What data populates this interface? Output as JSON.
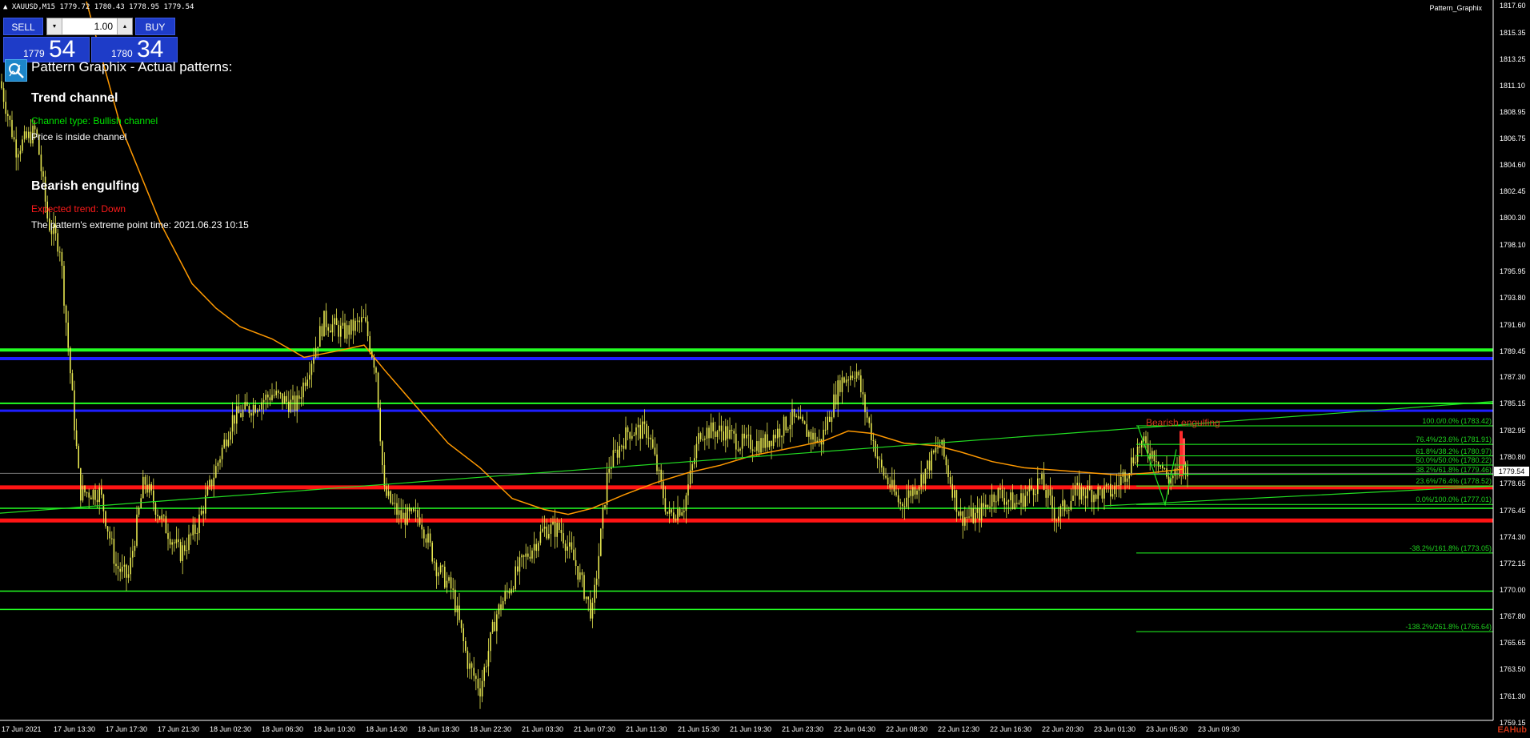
{
  "header": {
    "symbol_line": "▲ XAUUSD,M15  1779.72 1780.43 1778.95 1779.54",
    "indicator_label": "Pattern_Graphix"
  },
  "trade_panel": {
    "sell_label": "SELL",
    "buy_label": "BUY",
    "lot": "1.00",
    "spin_down": "▾",
    "spin_up": "▴",
    "sell_small": "1779",
    "sell_big": "54",
    "buy_small": "1780",
    "buy_big": "34"
  },
  "pattern_panel": {
    "title": "Pattern Graphix - Actual patterns:",
    "trend_channel_heading": "Trend channel",
    "channel_type": "Channel type: Bullish channel",
    "channel_status": "Price is inside channel",
    "engulfing_heading": "Bearish engulfing",
    "expected_trend": "Expected trend: Down",
    "extreme_time": "The pattern's extreme point time: 2021.06.23 10:15"
  },
  "price_axis": {
    "ticks": [
      "1817.60",
      "1815.35",
      "1813.25",
      "1811.10",
      "1808.95",
      "1806.75",
      "1804.60",
      "1802.45",
      "1800.30",
      "1798.10",
      "1795.95",
      "1793.80",
      "1791.60",
      "1789.45",
      "1787.30",
      "1785.15",
      "1782.95",
      "1780.80",
      "1778.65",
      "1776.45",
      "1774.30",
      "1772.15",
      "1770.00",
      "1767.80",
      "1765.65",
      "1763.50",
      "1761.30",
      "1759.15"
    ],
    "current_price": "1779.54"
  },
  "time_axis": {
    "labels": [
      "17 Jun 2021",
      "17 Jun 13:30",
      "17 Jun 17:30",
      "17 Jun 21:30",
      "18 Jun 02:30",
      "18 Jun 06:30",
      "18 Jun 10:30",
      "18 Jun 14:30",
      "18 Jun 18:30",
      "18 Jun 22:30",
      "21 Jun 03:30",
      "21 Jun 07:30",
      "21 Jun 11:30",
      "21 Jun 15:30",
      "21 Jun 19:30",
      "21 Jun 23:30",
      "22 Jun 04:30",
      "22 Jun 08:30",
      "22 Jun 12:30",
      "22 Jun 16:30",
      "22 Jun 20:30",
      "23 Jun 01:30",
      "23 Jun 05:30",
      "23 Jun 09:30"
    ]
  },
  "fib_levels": [
    {
      "label": "100.0/0.0% (1783.42)",
      "price": 1783.42
    },
    {
      "label": "76.4%/23.6% (1781.91)",
      "price": 1781.91
    },
    {
      "label": "61.8%/38.2% (1780.97)",
      "price": 1780.97
    },
    {
      "label": "50.0%/50.0% (1780.22)",
      "price": 1780.22
    },
    {
      "label": "38.2%/61.8% (1779.46)",
      "price": 1779.46
    },
    {
      "label": "23.6%/76.4% (1778.52)",
      "price": 1778.52
    },
    {
      "label": "0.0%/100.0% (1777.01)",
      "price": 1777.01
    },
    {
      "label": "-38.2%/161.8% (1773.05)",
      "price": 1773.05
    },
    {
      "label": "-138.2%/261.8% (1766.64)",
      "price": 1766.64
    }
  ],
  "chart_annotations": {
    "engulfing_label": "Bearish engulfing",
    "watermark": "EAHub"
  },
  "colors": {
    "candle": "#e6e650",
    "ma_line": "#ff9900",
    "support_green": "#22ff22",
    "resistance_blue": "#1e1eff",
    "red_level": "#ff1414",
    "channel": "#22dd22"
  }
}
